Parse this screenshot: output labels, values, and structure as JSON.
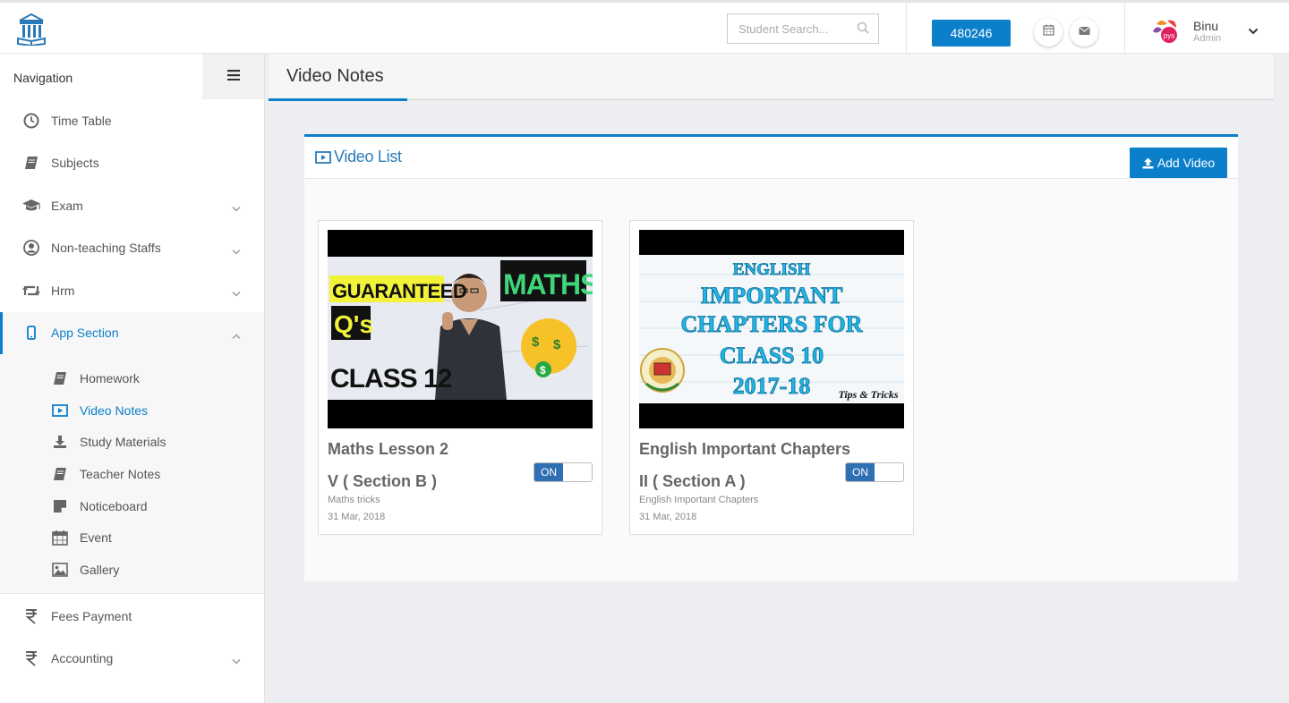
{
  "header": {
    "search_placeholder": "Student Search...",
    "code_badge": "480246",
    "user_name": "Binu",
    "user_role": "Admin",
    "accent": "#0b7fc9"
  },
  "sidebar": {
    "title": "Navigation",
    "items": [
      {
        "label": "Time Table",
        "icon": "clock-icon"
      },
      {
        "label": "Subjects",
        "icon": "book-icon"
      },
      {
        "label": "Exam",
        "icon": "graduation-cap-icon"
      },
      {
        "label": "Non-teaching Staffs",
        "icon": "user-circle-icon"
      },
      {
        "label": "Hrm",
        "icon": "retweet-icon"
      },
      {
        "label": "App Section",
        "icon": "mobile-icon"
      }
    ],
    "sub_items": [
      {
        "label": "Homework",
        "icon": "book-icon"
      },
      {
        "label": "Video Notes",
        "icon": "video-play-icon"
      },
      {
        "label": "Study Materials",
        "icon": "download-icon"
      },
      {
        "label": "Teacher Notes",
        "icon": "book-icon"
      },
      {
        "label": "Noticeboard",
        "icon": "sticky-note-icon"
      },
      {
        "label": "Event",
        "icon": "calendar-icon"
      },
      {
        "label": "Gallery",
        "icon": "image-icon"
      }
    ],
    "bottom_items": [
      {
        "label": "Fees Payment",
        "icon": "rupee-icon"
      },
      {
        "label": "Accounting",
        "icon": "rupee-icon"
      }
    ]
  },
  "page": {
    "title": "Video Notes",
    "panel_title": "Video List",
    "add_button": "Add Video"
  },
  "videos": [
    {
      "title": "Maths Lesson 2",
      "class_section": "V ( Section B )",
      "description": "Maths tricks",
      "date": "31 Mar, 2018",
      "toggle": "ON",
      "thumb_text": [
        "GUARANTEED",
        "Q's",
        "CLASS 12",
        "MATHS"
      ]
    },
    {
      "title": "English Important Chapters",
      "class_section": "II ( Section A )",
      "description": "English Important Chapters",
      "date": "31 Mar, 2018",
      "toggle": "ON",
      "thumb_text": [
        "ENGLISH",
        "IMPORTANT",
        "CHAPTERS FOR",
        "CLASS 10",
        "2017-18",
        "Tips & Tricks"
      ]
    }
  ]
}
